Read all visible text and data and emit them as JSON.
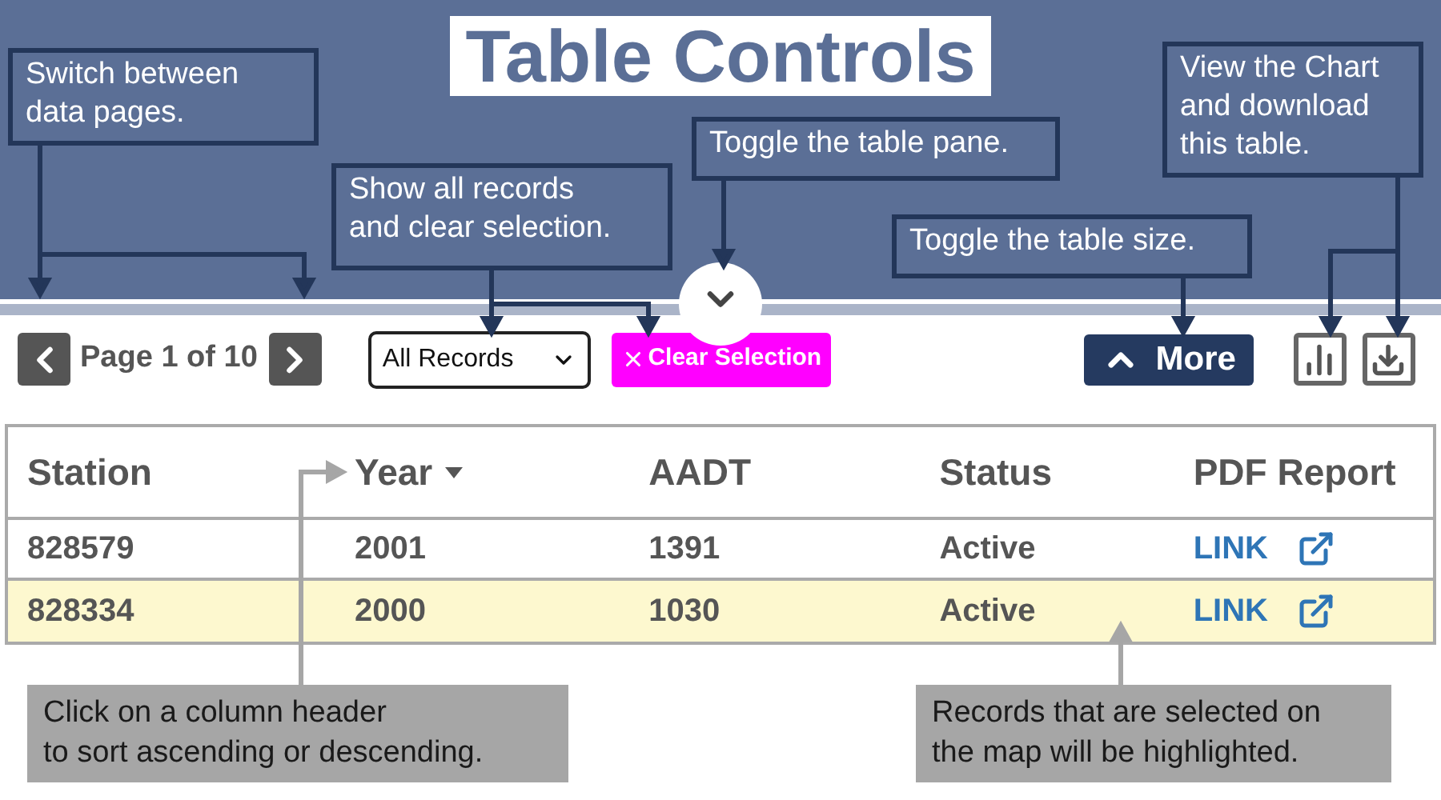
{
  "title": "Table Controls",
  "pager": {
    "label": "Page 1 of 10"
  },
  "record_filter": {
    "value": "All Records"
  },
  "clear_button": {
    "label": "Clear Selection"
  },
  "more_button": {
    "label": "More"
  },
  "table": {
    "columns": [
      {
        "label": "Station",
        "sorted": false
      },
      {
        "label": "Year",
        "sorted": true
      },
      {
        "label": "AADT",
        "sorted": false
      },
      {
        "label": "Status",
        "sorted": false
      },
      {
        "label": "PDF Report",
        "sorted": false
      }
    ],
    "rows": [
      {
        "cells": [
          "828579",
          "2001",
          "1391",
          "Active"
        ],
        "link": "LINK",
        "selected": false
      },
      {
        "cells": [
          "828334",
          "2000",
          "1030",
          "Active"
        ],
        "link": "LINK",
        "selected": true
      }
    ]
  },
  "callouts": [
    {
      "kind": "dark",
      "lines": [
        "Switch between",
        "data pages."
      ]
    },
    {
      "kind": "dark",
      "lines": [
        "Show all records",
        "and clear selection."
      ]
    },
    {
      "kind": "dark",
      "lines": [
        "Toggle the table pane."
      ]
    },
    {
      "kind": "dark",
      "lines": [
        "Toggle the table size."
      ]
    },
    {
      "kind": "dark",
      "lines": [
        "View the Chart",
        "and download",
        "this table."
      ]
    },
    {
      "kind": "gray",
      "lines": [
        "Click on a column header",
        "to sort ascending or descending."
      ]
    },
    {
      "kind": "gray",
      "lines": [
        "Records that are selected on",
        "the map will be highlighted."
      ]
    }
  ]
}
